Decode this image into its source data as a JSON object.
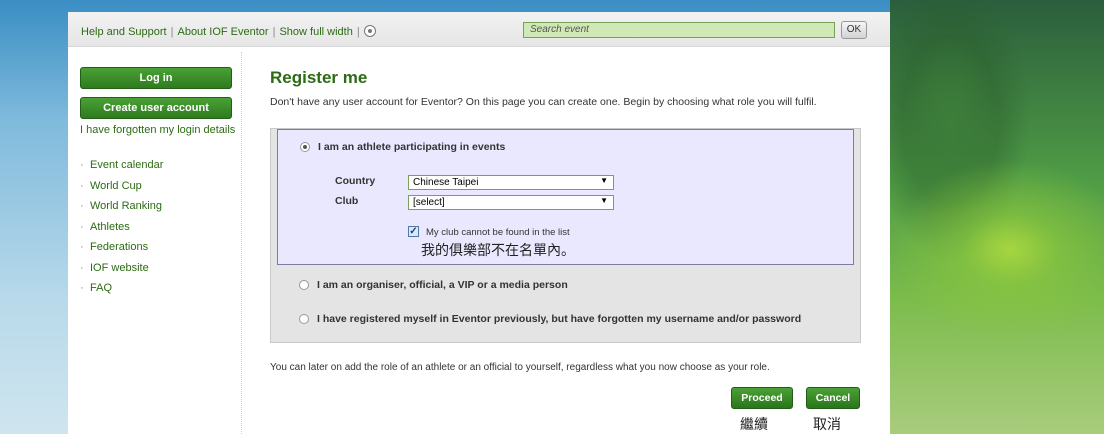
{
  "topbar": {
    "links": [
      "Help and Support",
      "About IOF Eventor",
      "Show full width"
    ],
    "separator": "|",
    "search_placeholder": "Search event",
    "ok_label": "OK"
  },
  "sidebar": {
    "login_label": "Log in",
    "create_account_label": "Create user account",
    "forgot_label": "I have forgotten my login details",
    "nav": [
      "Event calendar",
      "World Cup",
      "World Ranking",
      "Athletes",
      "Federations",
      "IOF website",
      "FAQ"
    ]
  },
  "main": {
    "title": "Register me",
    "intro": "Don't have any user account for Eventor? On this page you can create one. Begin by choosing what role you will fulfil.",
    "option_athlete": "I am an athlete participating in events",
    "country_label": "Country",
    "country_value": "Chinese Taipei",
    "club_label": "Club",
    "club_value": "[select]",
    "club_not_found_label": "My club cannot be found in the list",
    "club_not_found_checked": true,
    "club_not_found_zh": "我的俱樂部不在名單內。",
    "option_organiser": "I am an organiser, official, a VIP or a media person",
    "option_registered": "I have registered myself in Eventor previously, but have forgotten my username and/or password",
    "note": "You can later on add the role of an athlete or an official to yourself, regardless what you now choose as your role.",
    "proceed_label": "Proceed",
    "proceed_zh": "繼續",
    "cancel_label": "Cancel",
    "cancel_zh": "取消"
  },
  "colors": {
    "accent_green": "#2c6b13",
    "button_green": "#3a8f28",
    "selected_option_bg": "#e9e8ff",
    "options_box_bg": "#e4e4e4"
  }
}
